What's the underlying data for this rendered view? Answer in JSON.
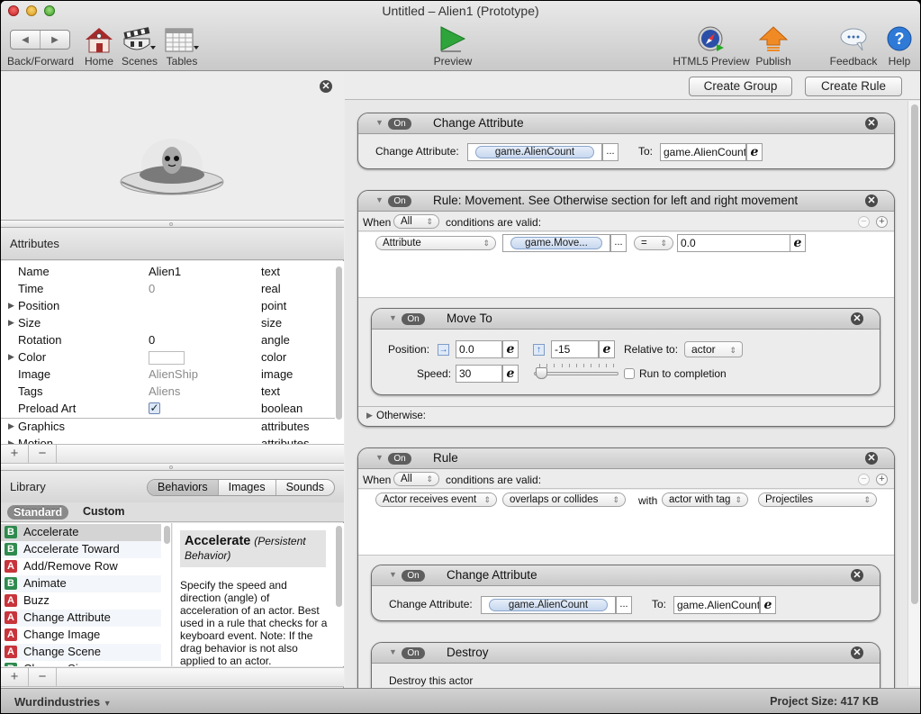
{
  "window": {
    "title": "Untitled – Alien1 (Prototype)"
  },
  "toolbar": {
    "back_forward": "Back/Forward",
    "home": "Home",
    "scenes": "Scenes",
    "tables": "Tables",
    "preview": "Preview",
    "html5_preview": "HTML5 Preview",
    "publish": "Publish",
    "feedback": "Feedback",
    "help": "Help"
  },
  "left": {
    "attributes_title": "Attributes",
    "attributes": [
      {
        "name": "Name",
        "value": "Alien1",
        "type": "text",
        "expandable": false,
        "muted": false
      },
      {
        "name": "Time",
        "value": "0",
        "type": "real",
        "expandable": false,
        "muted": true
      },
      {
        "name": "Position",
        "value": "",
        "type": "point",
        "expandable": true,
        "muted": false
      },
      {
        "name": "Size",
        "value": "",
        "type": "size",
        "expandable": true,
        "muted": false
      },
      {
        "name": "Rotation",
        "value": "0",
        "type": "angle",
        "expandable": false,
        "muted": false
      },
      {
        "name": "Color",
        "value": "",
        "type": "color",
        "expandable": true,
        "muted": false
      },
      {
        "name": "Image",
        "value": "AlienShip",
        "type": "image",
        "expandable": false,
        "muted": true
      },
      {
        "name": "Tags",
        "value": "Aliens",
        "type": "text",
        "expandable": false,
        "muted": true
      },
      {
        "name": "Preload Art",
        "value": "checked",
        "type": "boolean",
        "expandable": false,
        "muted": false
      },
      {
        "name": "Graphics",
        "value": "",
        "type": "attributes",
        "expandable": true,
        "muted": false
      },
      {
        "name": "Motion",
        "value": "",
        "type": "attributes",
        "expandable": true,
        "muted": false
      }
    ],
    "library_title": "Library",
    "library_tabs": [
      "Behaviors",
      "Images",
      "Sounds"
    ],
    "library_selected_tab": "Behaviors",
    "subtabs": {
      "standard": "Standard",
      "custom": "Custom"
    },
    "behaviors": [
      {
        "badge": "B",
        "label": "Accelerate"
      },
      {
        "badge": "B",
        "label": "Accelerate Toward"
      },
      {
        "badge": "A",
        "label": "Add/Remove Row"
      },
      {
        "badge": "B",
        "label": "Animate"
      },
      {
        "badge": "A",
        "label": "Buzz"
      },
      {
        "badge": "A",
        "label": "Change Attribute"
      },
      {
        "badge": "A",
        "label": "Change Image"
      },
      {
        "badge": "A",
        "label": "Change Scene"
      },
      {
        "badge": "B",
        "label": "Change Size"
      }
    ],
    "description": {
      "title": "Accelerate",
      "subtitle": "(Persistent Behavior)",
      "body": "Specify the speed and direction (angle) of acceleration of an actor. Best used in a rule that checks for a keyboard event. Note: If the drag behavior is not also applied to an actor."
    },
    "plus": "+",
    "minus": "−"
  },
  "right": {
    "create_group": "Create Group",
    "create_rule": "Create Rule",
    "on_label": "On",
    "block1": {
      "title": "Change Attribute",
      "attr_label": "Change Attribute:",
      "attr_value": "game.AlienCount",
      "dots": "...",
      "to_label": "To:",
      "to_value": "game.AlienCount"
    },
    "block2": {
      "title": "Rule: Movement.  See Otherwise section for left and right movement",
      "when": "When",
      "all": "All",
      "conditions": "conditions are valid:",
      "cond_type": "Attribute",
      "cond_attr": "game.Move...",
      "dots": "...",
      "operator": "=",
      "cond_value": "0.0",
      "otherwise": "Otherwise:",
      "moveto": {
        "title": "Move To",
        "position_label": "Position:",
        "x_value": "0.0",
        "y_value": "-15",
        "relative_label": "Relative to:",
        "relative_value": "actor",
        "speed_label": "Speed:",
        "speed_value": "30",
        "speed_slider_fraction": 0.03,
        "run_to_completion": "Run to completion",
        "run_checked": false
      }
    },
    "block3": {
      "title": "Rule",
      "when": "When",
      "all": "All",
      "conditions": "conditions are valid:",
      "cond_type": "Actor receives event",
      "cond_event": "overlaps or collides",
      "with": "with",
      "cond_target": "actor with tag",
      "cond_tag": "Projectiles",
      "change_attr": {
        "title": "Change Attribute",
        "attr_label": "Change Attribute:",
        "attr_value": "game.AlienCount",
        "dots": "...",
        "to_label": "To:",
        "to_value": "game.AlienCount"
      },
      "destroy": {
        "title": "Destroy",
        "body": "Destroy this actor"
      }
    }
  },
  "bottom": {
    "organization": "Wurdindustries",
    "project_size": "Project Size: 417 KB"
  }
}
